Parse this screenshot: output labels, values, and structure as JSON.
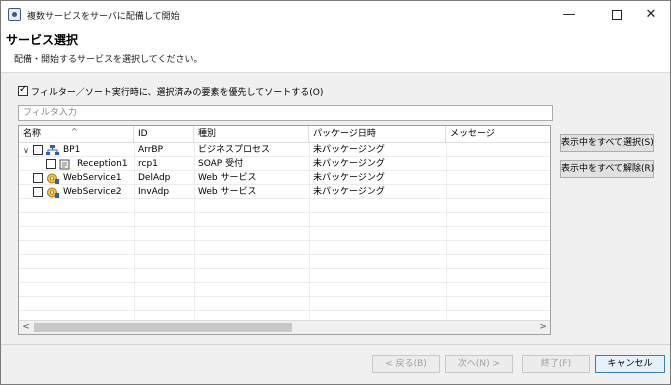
{
  "window": {
    "title": "複数サービスをサーバに配備して開始",
    "minimize_glyph": "—",
    "maximize_glyph": "",
    "close_glyph": "✕"
  },
  "header": {
    "title": "サービス選択",
    "description": "配備・開始するサービスを選択してください。"
  },
  "sort_option": {
    "label": "フィルター／ソート実行時に、選択済みの要素を優先してソートする(O)",
    "checked": true
  },
  "filter": {
    "placeholder": "フィルタ入力",
    "value": ""
  },
  "table": {
    "sort_indicator": "^",
    "columns": [
      "名称",
      "ID",
      "種別",
      "パッケージ日時",
      "メッセージ"
    ],
    "rows": [
      {
        "name": "BP1",
        "id": "ArrBP",
        "type": "ビジネスプロセス",
        "package_date": "未パッケージング",
        "message": "",
        "expand": "∨",
        "icon": "business-process-icon"
      },
      {
        "name": "Reception1",
        "id": "rcp1",
        "type": "SOAP 受付",
        "package_date": "未パッケージング",
        "message": "",
        "expand": "",
        "icon": "reception-icon"
      },
      {
        "name": "WebService1",
        "id": "DelAdp",
        "type": "Web サービス",
        "package_date": "未パッケージング",
        "message": "",
        "expand": "",
        "icon": "web-service-icon"
      },
      {
        "name": "WebService2",
        "id": "InvAdp",
        "type": "Web サービス",
        "package_date": "未パッケージング",
        "message": "",
        "expand": "",
        "icon": "web-service-icon"
      }
    ],
    "scroll_left": "<",
    "scroll_right": ">"
  },
  "side_buttons": {
    "select_all": "表示中をすべて選択(S)",
    "deselect_all": "表示中をすべて解除(R)"
  },
  "footer": {
    "back": "< 戻る(B)",
    "next": "次へ(N) >",
    "finish": "終了(F)",
    "cancel": "キャンセル"
  },
  "colors": {
    "accent": "#3c7fb1",
    "disabled_text": "#a0a0a0",
    "icon_blue": "#2b5fb4",
    "icon_gold": "#d9a520"
  }
}
